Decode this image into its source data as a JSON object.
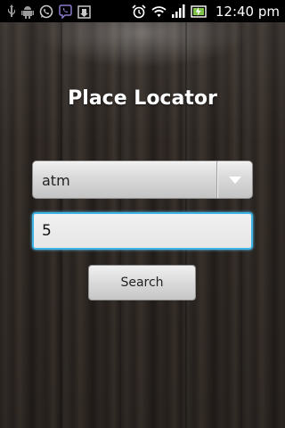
{
  "status_bar": {
    "time": "12:40 pm",
    "icons": [
      "usb-icon",
      "android-debug-icon",
      "whatsapp-icon",
      "viber-icon",
      "download-icon",
      "alarm-icon",
      "wifi-icon",
      "signal-icon",
      "battery-icon"
    ]
  },
  "app": {
    "title": "Place Locator",
    "place_type": {
      "selected": "atm"
    },
    "radius_input": {
      "value": "5"
    },
    "search_button": {
      "label": "Search"
    }
  },
  "colors": {
    "input_focus_border": "#3fb3e6",
    "title_text": "#ffffff",
    "status_bar_bg": "#000000"
  }
}
